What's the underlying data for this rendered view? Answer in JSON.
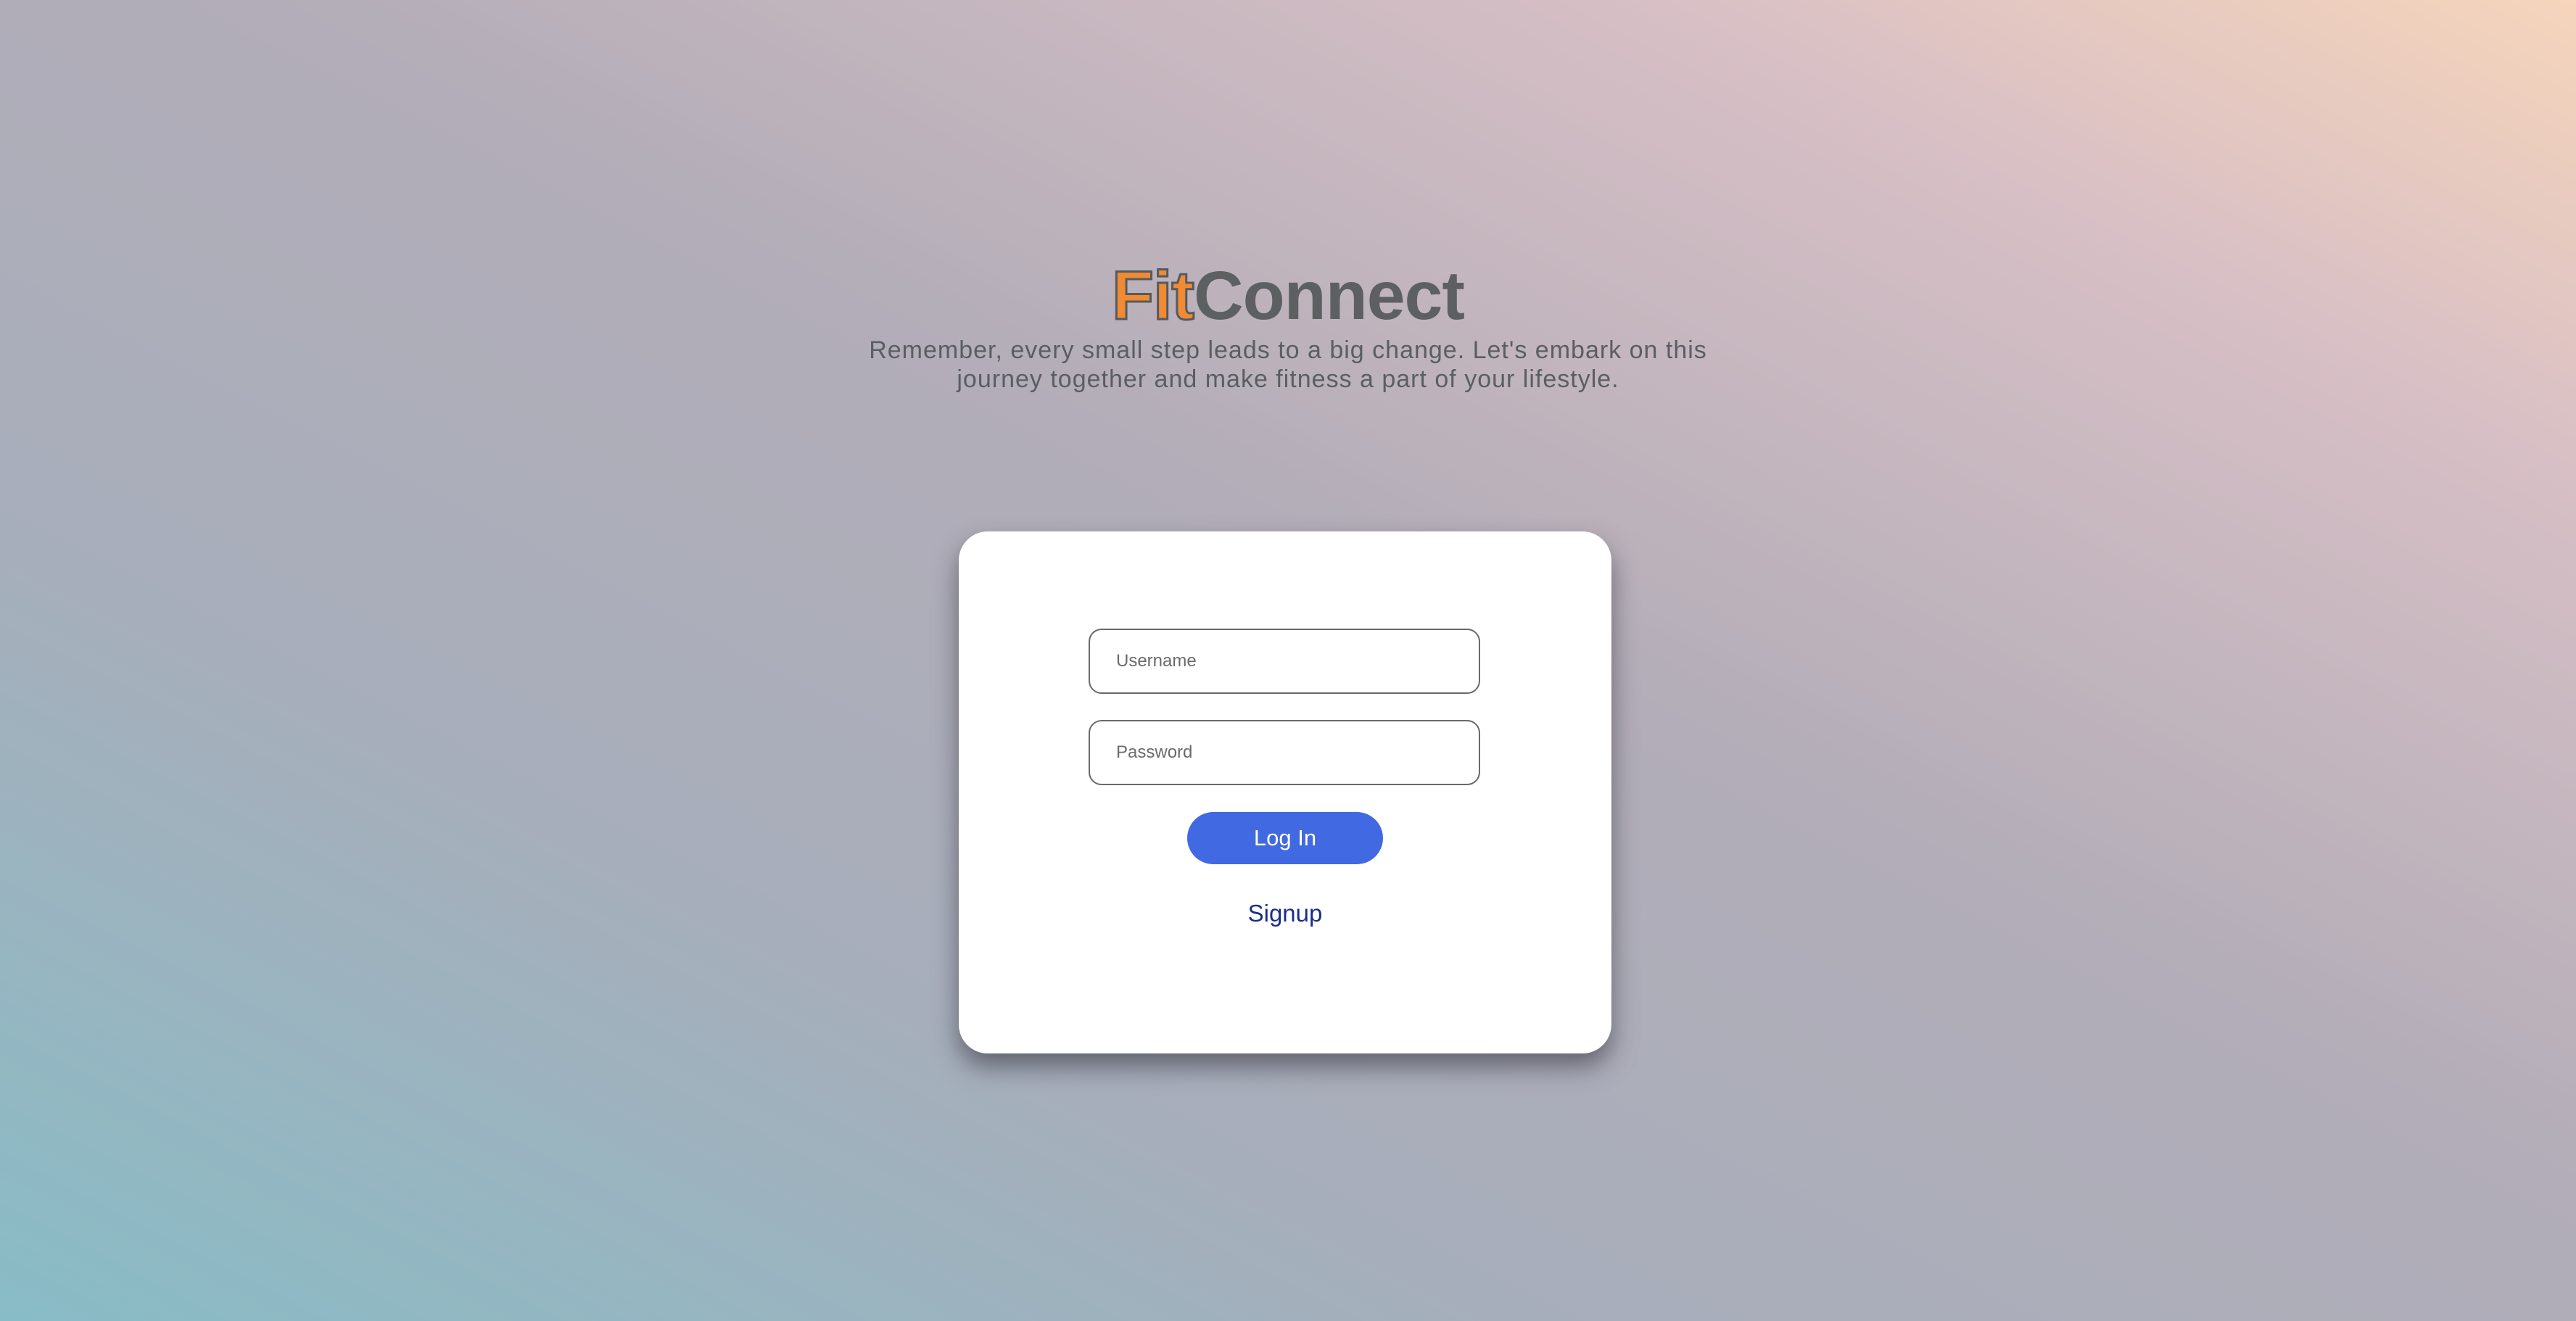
{
  "brand": {
    "part1": "Fit",
    "part2": "Connect"
  },
  "tagline": {
    "line1": "Remember, every small step leads to a big change. Let's embark on this",
    "line2": "journey together and make fitness a part of your lifestyle."
  },
  "login_form": {
    "username_placeholder": "Username",
    "username_value": "",
    "password_placeholder": "Password",
    "password_value": "",
    "login_label": "Log In",
    "signup_label": "Signup"
  },
  "colors": {
    "brand_accent": "#f08a33",
    "brand_text": "#5c6062",
    "button": "#4169e1",
    "link": "#1a2d8a"
  }
}
